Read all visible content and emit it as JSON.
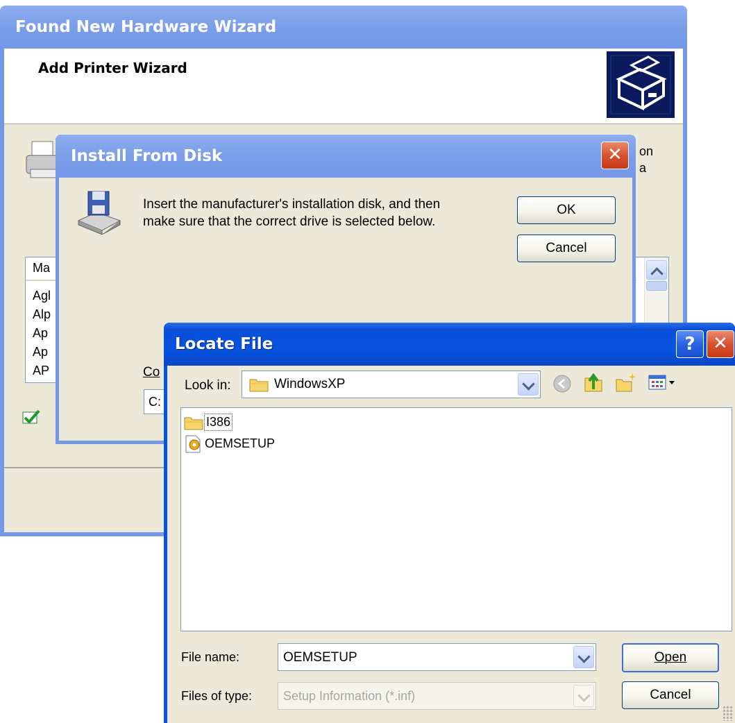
{
  "hardware_wizard": {
    "title": "Found New Hardware Wizard",
    "header_title": "Add Printer Wizard",
    "partial_text_1": "on",
    "partial_text_2": "a",
    "list_header_partial": "Ma",
    "list_items_partial": [
      "Agl",
      "Alp",
      "Ap",
      "Ap",
      "AP"
    ]
  },
  "install_from_disk": {
    "title": "Install From Disk",
    "message_line1": "Insert the manufacturer's installation disk, and then",
    "message_line2": "make sure that the correct drive is selected below.",
    "ok_label": "OK",
    "cancel_label": "Cancel",
    "copy_label_partial": "Co",
    "path_value_partial": "C:"
  },
  "locate_file": {
    "title": "Locate File",
    "help_glyph": "?",
    "close_glyph": "✕",
    "look_in_label": "Look in:",
    "look_in_value": "WindowsXP",
    "files": [
      {
        "name": "I386",
        "icon": "folder-icon"
      },
      {
        "name": "OEMSETUP",
        "icon": "setup-file-icon"
      }
    ],
    "file_name_label": "File name:",
    "file_name_value": "OEMSETUP",
    "files_of_type_label": "Files of type:",
    "files_of_type_value": "Setup Information (*.inf)",
    "open_label": "Open",
    "cancel_label": "Cancel"
  },
  "colors": {
    "titlebar_active": "#0553de",
    "titlebar_inactive": "#7a9ee9",
    "dialog_face": "#ece9d8",
    "close_red": "#d8512f"
  }
}
